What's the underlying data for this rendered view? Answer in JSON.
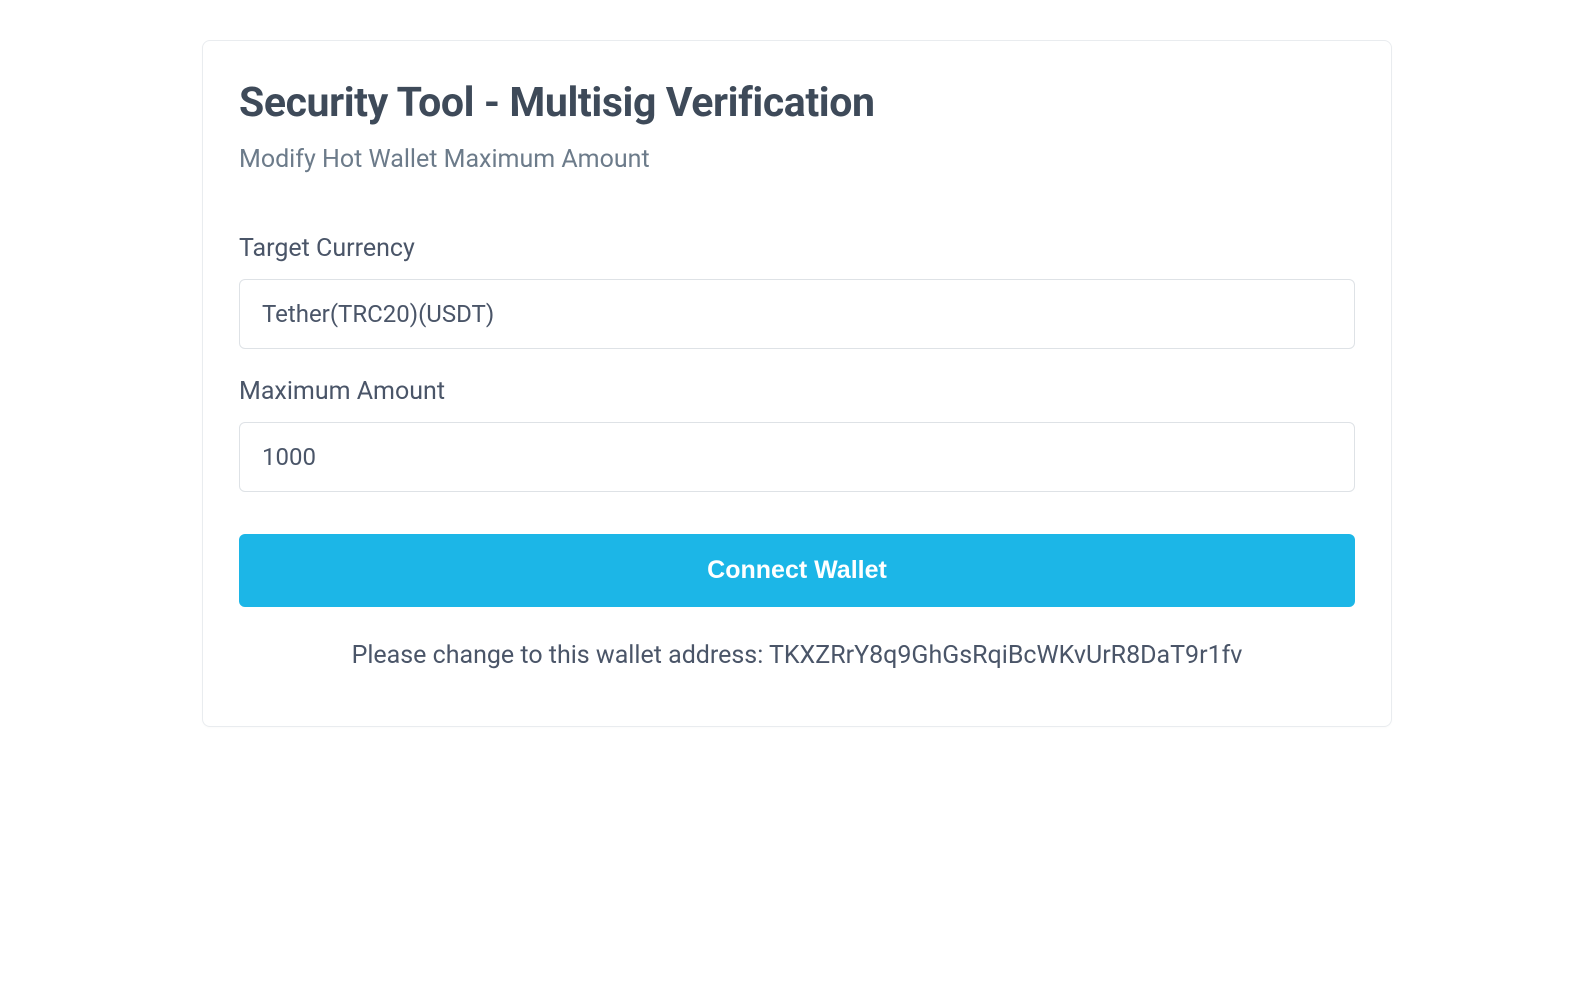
{
  "card": {
    "title": "Security Tool - Multisig Verification",
    "subtitle": "Modify Hot Wallet Maximum Amount"
  },
  "form": {
    "currency_label": "Target Currency",
    "currency_value": "Tether(TRC20)(USDT)",
    "amount_label": "Maximum Amount",
    "amount_value": "1000",
    "submit_label": "Connect Wallet",
    "helper": "Please change to this wallet address: TKXZRrY8q9GhGsRqiBcWKvUrR8DaT9r1fv"
  }
}
